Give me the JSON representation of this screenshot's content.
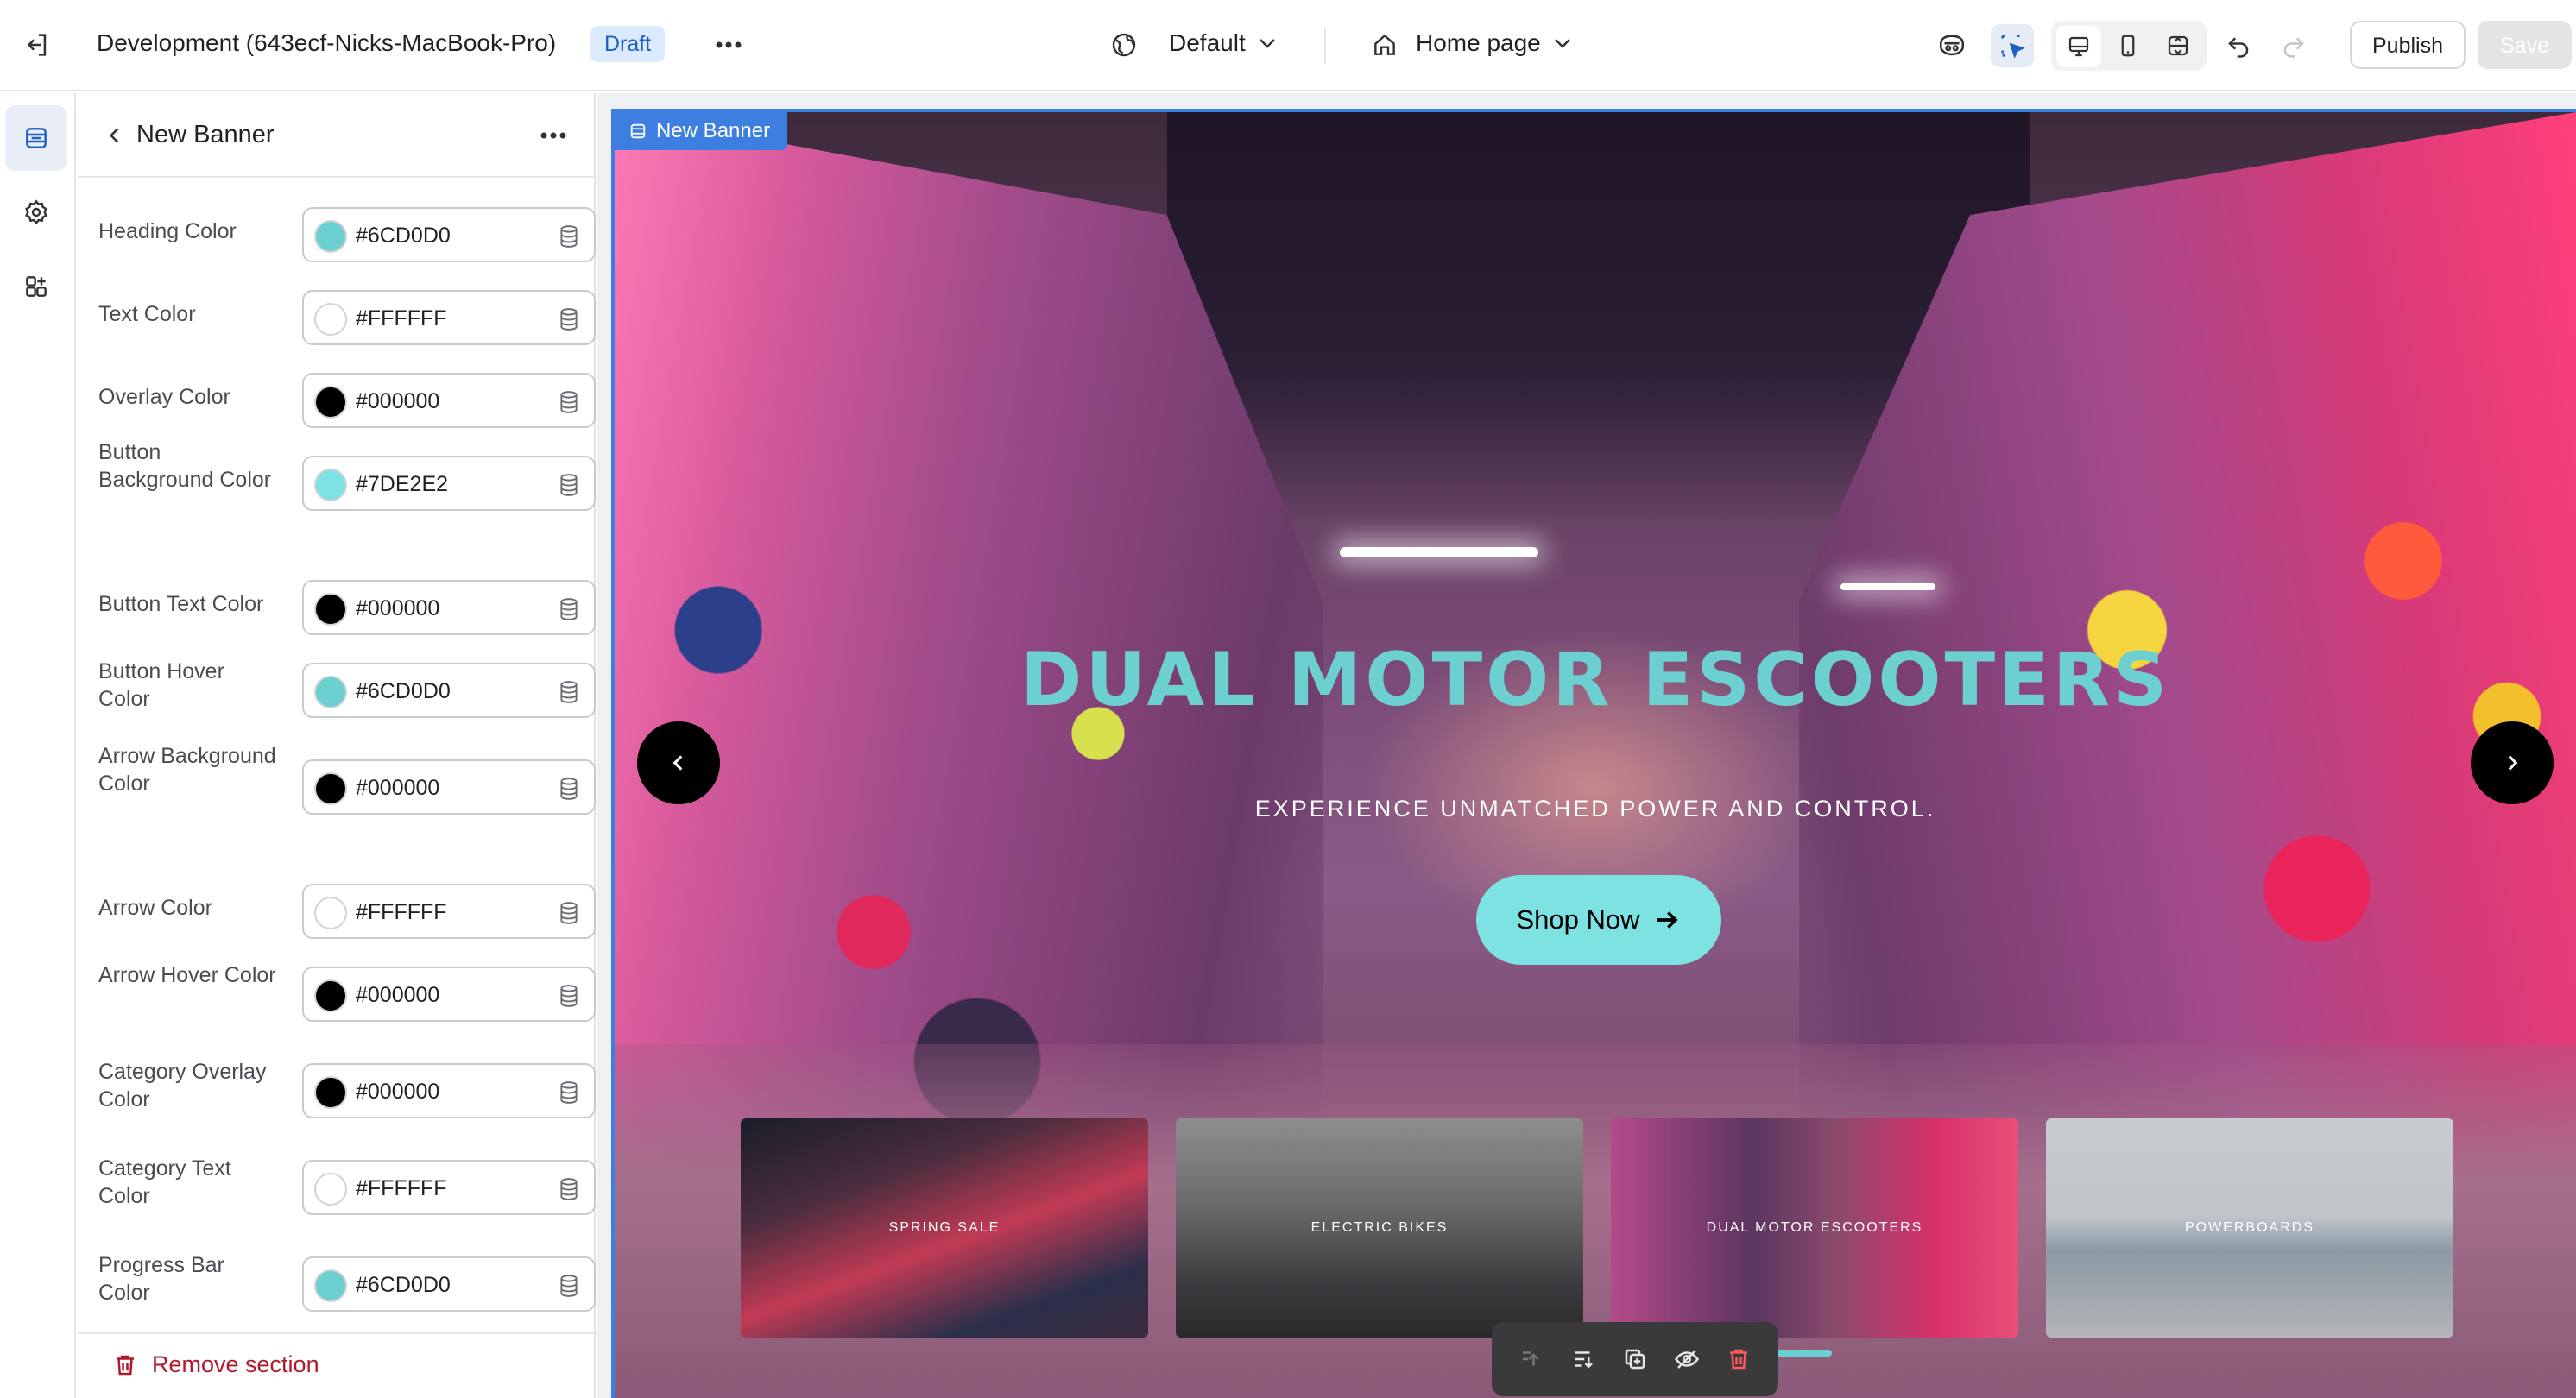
{
  "topbar": {
    "title": "Development (643ecf-Nicks-MacBook-Pro)",
    "status_badge": "Draft",
    "theme_selector": "Default",
    "page_selector": "Home page",
    "publish_label": "Publish",
    "save_label": "Save"
  },
  "rail": {
    "items": [
      "sections-icon",
      "gear-icon",
      "apps-icon"
    ]
  },
  "panel": {
    "title": "New Banner",
    "fields": [
      {
        "label": "Heading Color",
        "value": "#6CD0D0",
        "swatch": "#6CD0D0"
      },
      {
        "label": "Text Color",
        "value": "#FFFFFF",
        "swatch": "#FFFFFF"
      },
      {
        "label": "Overlay Color",
        "value": "#000000",
        "swatch": "#000000"
      },
      {
        "label": "Button Background Color",
        "value": "#7DE2E2",
        "swatch": "#7DE2E2"
      },
      {
        "label": "Button Text Color",
        "value": "#000000",
        "swatch": "#000000"
      },
      {
        "label": "Button Hover Color",
        "value": "#6CD0D0",
        "swatch": "#6CD0D0"
      },
      {
        "label": "Arrow Background Color",
        "value": "#000000",
        "swatch": "#000000"
      },
      {
        "label": "Arrow Color",
        "value": "#FFFFFF",
        "swatch": "#FFFFFF"
      },
      {
        "label": "Arrow Hover Color",
        "value": "#000000",
        "swatch": "#000000"
      },
      {
        "label": "Category Overlay Color",
        "value": "#000000",
        "swatch": "#000000"
      },
      {
        "label": "Category Text Color",
        "value": "#FFFFFF",
        "swatch": "#FFFFFF"
      },
      {
        "label": "Progress Bar Color",
        "value": "#6CD0D0",
        "swatch": "#6CD0D0"
      }
    ],
    "remove_label": "Remove section"
  },
  "preview": {
    "section_tag": "New Banner",
    "heading": "DUAL MOTOR ESCOOTERS",
    "subheading": "EXPERIENCE UNMATCHED POWER AND CONTROL.",
    "button_label": "Shop Now",
    "categories": [
      "SPRING SALE",
      "ELECTRIC BIKES",
      "DUAL MOTOR ESCOOTERS",
      "POWERBOARDS"
    ]
  },
  "colors": {
    "accent": "#3D7FE0",
    "heading": "#6CD0D0",
    "button_bg": "#7DE2E2",
    "danger": "#B0182B"
  }
}
